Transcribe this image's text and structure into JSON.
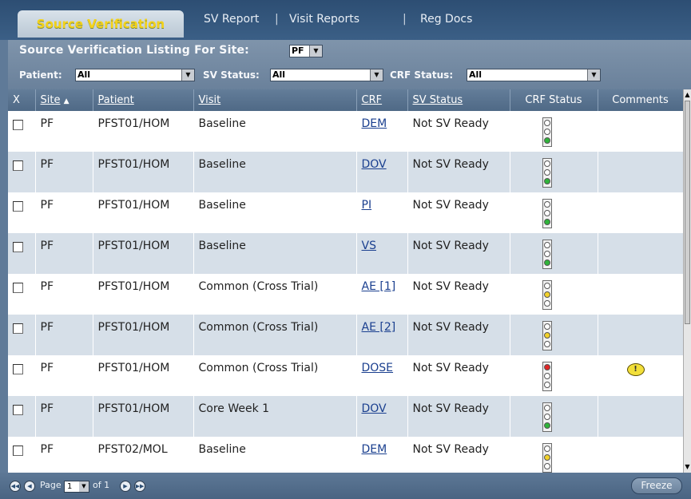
{
  "tabs": {
    "active": "Source Verification",
    "links": [
      "SV Report",
      "Visit Reports",
      "Reg Docs"
    ],
    "separator": "|"
  },
  "filters": {
    "heading": "Source Verification Listing For Site:",
    "site_value": "PF",
    "patient_label": "Patient:",
    "patient_value": "All",
    "sv_status_label": "SV Status:",
    "sv_status_value": "All",
    "crf_status_label": "CRF Status:",
    "crf_status_value": "All"
  },
  "columns": {
    "x": "X",
    "site": "Site",
    "site_sort": "▲",
    "patient": "Patient",
    "visit": "Visit",
    "crf": "CRF",
    "sv_status": "SV Status",
    "crf_status": "CRF Status",
    "comments": "Comments"
  },
  "rows": [
    {
      "site": "PF",
      "patient": "PFST01/HOM",
      "visit": "Baseline",
      "crf": "DEM",
      "sv_status": "Not SV Ready",
      "light": "green",
      "comment": ""
    },
    {
      "site": "PF",
      "patient": "PFST01/HOM",
      "visit": "Baseline",
      "crf": "DOV",
      "sv_status": "Not SV Ready",
      "light": "green",
      "comment": ""
    },
    {
      "site": "PF",
      "patient": "PFST01/HOM",
      "visit": "Baseline",
      "crf": "PI",
      "sv_status": "Not SV Ready",
      "light": "green",
      "comment": ""
    },
    {
      "site": "PF",
      "patient": "PFST01/HOM",
      "visit": "Baseline",
      "crf": "VS",
      "sv_status": "Not SV Ready",
      "light": "green",
      "comment": ""
    },
    {
      "site": "PF",
      "patient": "PFST01/HOM",
      "visit": "Common (Cross Trial)",
      "crf": "AE [1]",
      "sv_status": "Not SV Ready",
      "light": "yellow",
      "comment": ""
    },
    {
      "site": "PF",
      "patient": "PFST01/HOM",
      "visit": "Common (Cross Trial)",
      "crf": "AE [2]",
      "sv_status": "Not SV Ready",
      "light": "yellow",
      "comment": ""
    },
    {
      "site": "PF",
      "patient": "PFST01/HOM",
      "visit": "Common (Cross Trial)",
      "crf": "DOSE",
      "sv_status": "Not SV Ready",
      "light": "red",
      "comment": "!"
    },
    {
      "site": "PF",
      "patient": "PFST01/HOM",
      "visit": "Core Week 1",
      "crf": "DOV",
      "sv_status": "Not SV Ready",
      "light": "green",
      "comment": ""
    },
    {
      "site": "PF",
      "patient": "PFST02/MOL",
      "visit": "Baseline",
      "crf": "DEM",
      "sv_status": "Not SV Ready",
      "light": "yellow",
      "comment": ""
    }
  ],
  "pager": {
    "page_label": "Page",
    "page_value": "1",
    "of_label": "of 1",
    "freeze_label": "Freeze"
  },
  "colors": {
    "accent_tab_text": "#f3d21a",
    "header_bg": "#2d4e73",
    "alt_row": "#d6dfe8",
    "link": "#1a3f8f"
  }
}
